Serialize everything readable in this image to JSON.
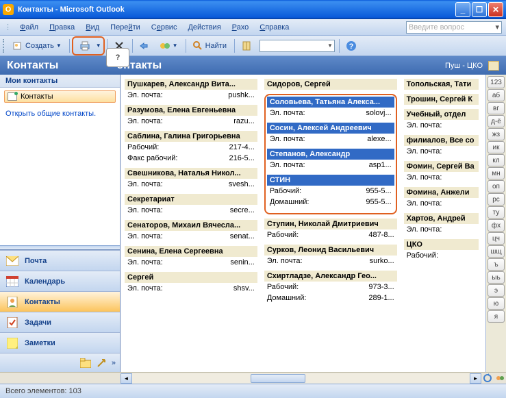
{
  "window": {
    "title": "Контакты - Microsoft Outlook"
  },
  "menu": {
    "file": "Файл",
    "edit": "Правка",
    "view": "Вид",
    "go": "Перейти",
    "tools": "Сервис",
    "actions": "Действия",
    "raxo": "Рахо",
    "help": "Справка",
    "search_placeholder": "Введите вопрос"
  },
  "toolbar": {
    "create": "Создать",
    "find": "Найти"
  },
  "hint": "?",
  "header": {
    "left": "Контакты",
    "mid": "онтакты",
    "right": "Пуш - ЦКО"
  },
  "nav": {
    "mycontacts": "Мои контакты",
    "contacts": "Контакты",
    "openshared": "Открыть общие контакты.",
    "mail": "Почта",
    "calendar": "Календарь",
    "contacts_btn": "Контакты",
    "tasks": "Задачи",
    "notes": "Заметки"
  },
  "labels": {
    "email": "Эл. почта:",
    "work": "Рабочий:",
    "workfax": "Факс рабочий:",
    "home": "Домашний:"
  },
  "col1": [
    {
      "name": "Пушкарев, Александр Вита...",
      "rows": [
        [
          "email",
          "pushk..."
        ]
      ]
    },
    {
      "name": "Разумова, Елена Евгеньевна",
      "rows": [
        [
          "email",
          "razu..."
        ]
      ]
    },
    {
      "name": "Саблина, Галина Григорьевна",
      "rows": [
        [
          "work",
          "217-4..."
        ],
        [
          "workfax",
          "216-5..."
        ]
      ]
    },
    {
      "name": "Свешникова, Наталья Никол...",
      "rows": [
        [
          "email",
          "svesh..."
        ]
      ]
    },
    {
      "name": "Секретариат",
      "rows": [
        [
          "email",
          "secre..."
        ]
      ]
    },
    {
      "name": "Сенаторов, Михаил Вячесла...",
      "rows": [
        [
          "email",
          "senat..."
        ]
      ]
    },
    {
      "name": "Сенина, Елена Сергеевна",
      "rows": [
        [
          "email",
          "senin..."
        ]
      ]
    },
    {
      "name": "Сергей",
      "rows": [
        [
          "email",
          "shsv..."
        ]
      ]
    }
  ],
  "col2_top": {
    "name": "Сидоров, Сергей",
    "rows": []
  },
  "col2_sel": [
    {
      "name": "Соловьева, Татьяна Алекса...",
      "rows": [
        [
          "email",
          "solovj..."
        ]
      ]
    },
    {
      "name": "Сосин, Алексей Андреевич",
      "rows": [
        [
          "email",
          "alexe..."
        ]
      ]
    },
    {
      "name": "Степанов, Александр",
      "rows": [
        [
          "email",
          "asp1..."
        ]
      ]
    },
    {
      "name": "СТИН",
      "rows": [
        [
          "work",
          "955-5..."
        ],
        [
          "home",
          "955-5..."
        ]
      ]
    }
  ],
  "col2_rest": [
    {
      "name": "Ступин, Николай Дмитриевич",
      "rows": [
        [
          "work",
          "487-8..."
        ]
      ]
    },
    {
      "name": "Сурков, Леонид Васильевич",
      "rows": [
        [
          "email",
          "surko..."
        ]
      ]
    },
    {
      "name": "Схиртладзе, Александр Гео...",
      "rows": [
        [
          "work",
          "973-3..."
        ],
        [
          "home",
          "289-1..."
        ]
      ]
    }
  ],
  "col3": [
    {
      "name": "Топольская, Тати",
      "rows": []
    },
    {
      "name": "Трошин, Сергей К",
      "rows": []
    },
    {
      "name": "Учебный, отдел",
      "rows": [
        [
          "email",
          ""
        ]
      ]
    },
    {
      "name": "филиалов, Все со",
      "rows": [
        [
          "email",
          ""
        ]
      ]
    },
    {
      "name": "Фомин, Сергей Ва",
      "rows": [
        [
          "email",
          ""
        ]
      ]
    },
    {
      "name": "Фомина, Анжели",
      "rows": [
        [
          "email",
          ""
        ]
      ]
    },
    {
      "name": "Хартов, Андрей",
      "rows": [
        [
          "email",
          ""
        ]
      ]
    },
    {
      "name": "ЦКО",
      "rows": [
        [
          "work",
          ""
        ]
      ]
    }
  ],
  "alpha": [
    "123",
    "аб",
    "вг",
    "д-ё",
    "жз",
    "ик",
    "кл",
    "мн",
    "оп",
    "рс",
    "ту",
    "фх",
    "цч",
    "шщ",
    "ъ",
    "ыь",
    "э",
    "ю",
    "я"
  ],
  "status": "Всего элементов: 103"
}
